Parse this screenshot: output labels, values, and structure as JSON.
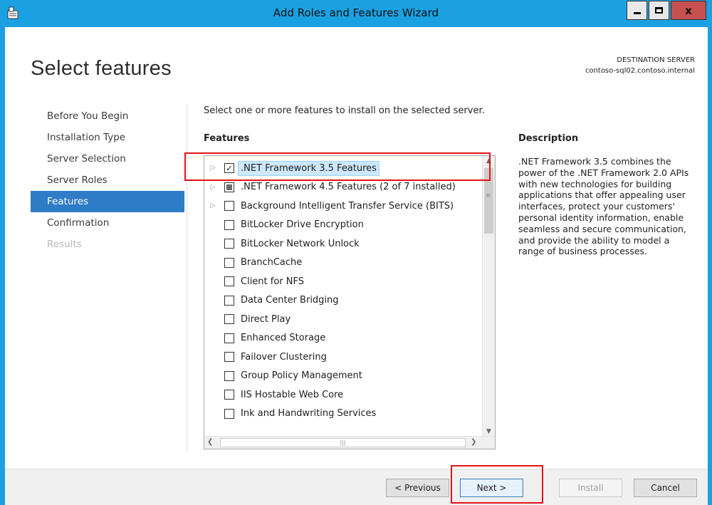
{
  "window": {
    "title": "Add Roles and Features Wizard",
    "close_label": "x"
  },
  "header": {
    "page_title": "Select features",
    "destination_label": "DESTINATION SERVER",
    "destination_server": "contoso-sql02.contoso.internal"
  },
  "nav": {
    "items": [
      {
        "label": "Before You Begin"
      },
      {
        "label": "Installation Type"
      },
      {
        "label": "Server Selection"
      },
      {
        "label": "Server Roles"
      },
      {
        "label": "Features"
      },
      {
        "label": "Confirmation"
      },
      {
        "label": "Results"
      }
    ]
  },
  "main": {
    "instruction": "Select one or more features to install on the selected server.",
    "features_header": "Features",
    "features": [
      {
        "label": ".NET Framework 3.5 Features",
        "expandable": true,
        "state": "checked",
        "selected": true
      },
      {
        "label": ".NET Framework 4.5 Features (2 of 7 installed)",
        "expandable": true,
        "state": "partial"
      },
      {
        "label": "Background Intelligent Transfer Service (BITS)",
        "expandable": true,
        "state": "unchecked"
      },
      {
        "label": "BitLocker Drive Encryption",
        "expandable": false,
        "state": "unchecked"
      },
      {
        "label": "BitLocker Network Unlock",
        "expandable": false,
        "state": "unchecked"
      },
      {
        "label": "BranchCache",
        "expandable": false,
        "state": "unchecked"
      },
      {
        "label": "Client for NFS",
        "expandable": false,
        "state": "unchecked"
      },
      {
        "label": "Data Center Bridging",
        "expandable": false,
        "state": "unchecked"
      },
      {
        "label": "Direct Play",
        "expandable": false,
        "state": "unchecked"
      },
      {
        "label": "Enhanced Storage",
        "expandable": false,
        "state": "unchecked"
      },
      {
        "label": "Failover Clustering",
        "expandable": false,
        "state": "unchecked"
      },
      {
        "label": "Group Policy Management",
        "expandable": false,
        "state": "unchecked"
      },
      {
        "label": "IIS Hostable Web Core",
        "expandable": false,
        "state": "unchecked"
      },
      {
        "label": "Ink and Handwriting Services",
        "expandable": false,
        "state": "unchecked"
      }
    ],
    "description_header": "Description",
    "description_text": ".NET Framework 3.5 combines the power of the .NET Framework 2.0 APIs with new technologies for building applications that offer appealing user interfaces, protect your customers' personal identity information, enable seamless and secure communication, and provide the ability to model a range of business processes."
  },
  "footer": {
    "previous_label": "< Previous",
    "next_label": "Next >",
    "install_label": "Install",
    "cancel_label": "Cancel"
  },
  "colors": {
    "titlebar": "#1ba1e2",
    "nav_active": "#2e7bc6",
    "highlight": "#e3131a"
  },
  "icons": {
    "app": "server-manager-icon",
    "expand": "triangle-right-icon"
  }
}
